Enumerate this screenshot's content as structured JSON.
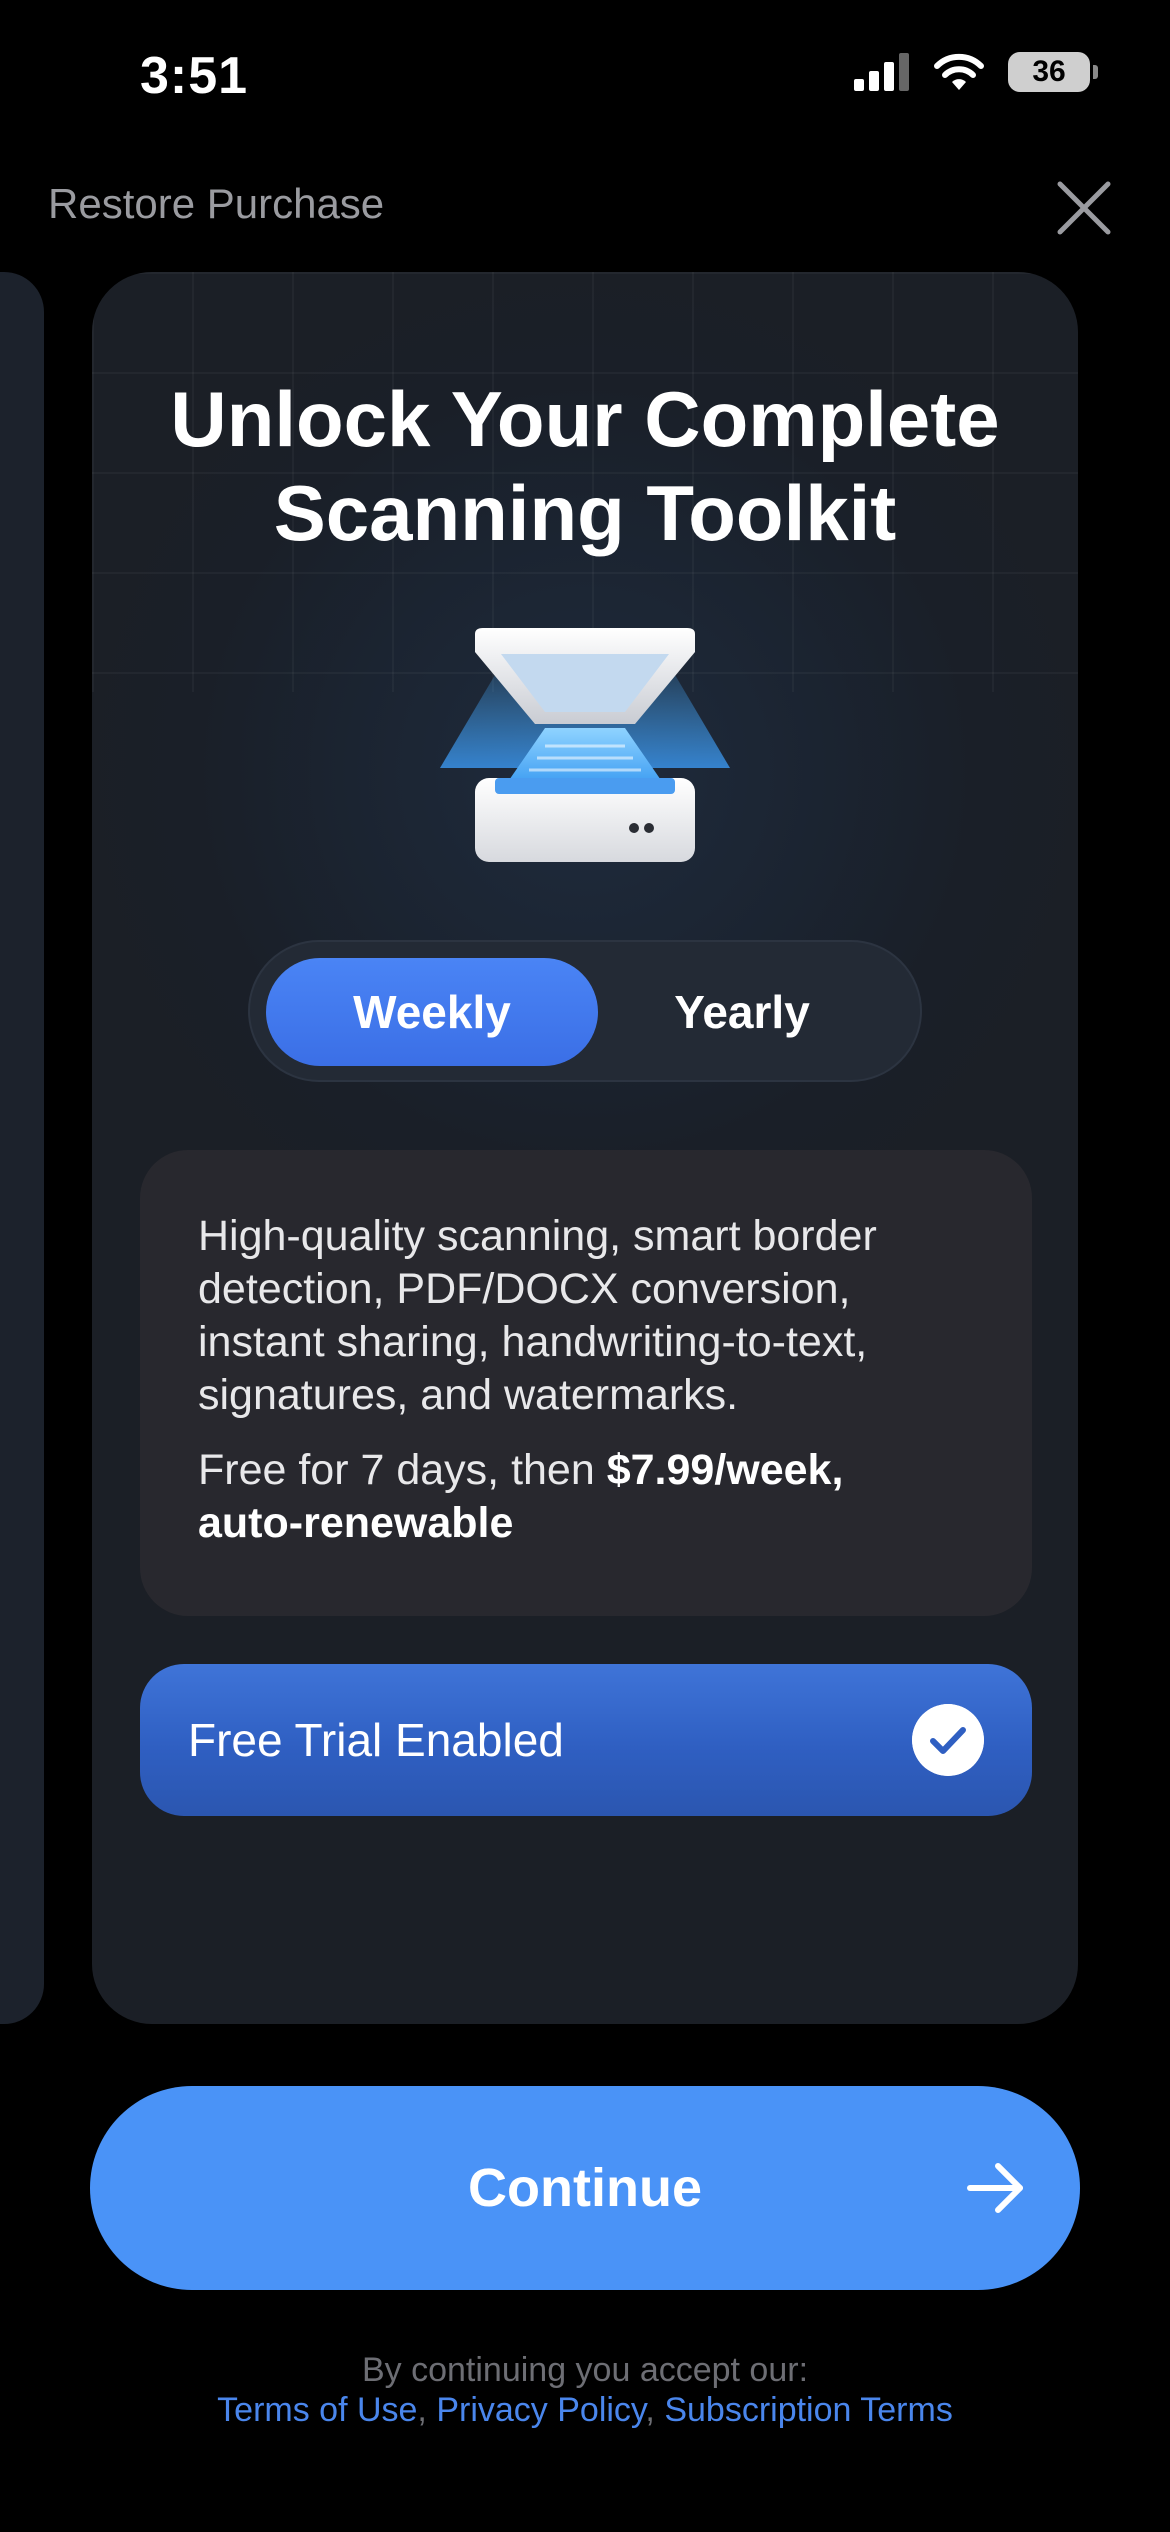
{
  "status_bar": {
    "time": "3:51",
    "battery": "36",
    "icons": [
      "cellular-signal-icon",
      "wifi-icon",
      "battery-icon"
    ]
  },
  "header": {
    "restore_label": "Restore Purchase",
    "close_icon": "close-icon"
  },
  "card": {
    "title_line1": "Unlock Your Complete",
    "title_line2": "Scanning Toolkit",
    "illustration": "scanner-icon",
    "plans": [
      {
        "label": "Weekly",
        "selected": true
      },
      {
        "label": "Yearly",
        "selected": false
      }
    ],
    "description": "High-quality scanning, smart border detection, PDF/DOCX conversion, instant sharing, handwriting-to-text, signatures, and watermarks.",
    "price_prefix": "Free for 7 days, then ",
    "price_bold_1": "$7.99/week,",
    "price_bold_2": "auto-renewable",
    "trial_label": "Free Trial Enabled",
    "trial_enabled": true
  },
  "continue": {
    "label": "Continue",
    "icon": "arrow-right-icon"
  },
  "footer": {
    "accept_text": "By continuing you accept our:",
    "links": [
      "Terms of Use",
      "Privacy Policy",
      "Subscription Terms"
    ],
    "separator": ", "
  },
  "colors": {
    "accent": "#4a93f7",
    "toggle_active": "#4a84f5",
    "link": "#4a86ec",
    "background": "#000000"
  }
}
